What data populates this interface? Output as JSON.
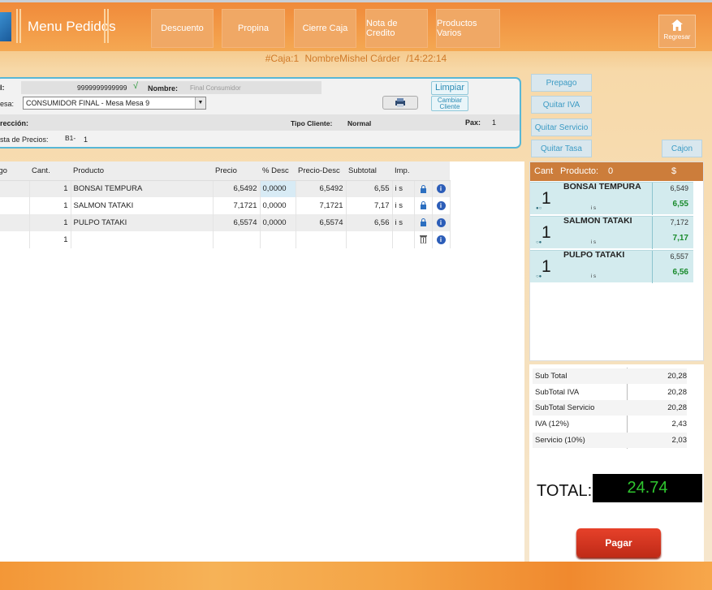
{
  "header": {
    "title": "Menu Pedidos",
    "buttons": [
      "Descuento",
      "Propina",
      "Cierre Caja",
      "Nota de Credito",
      "Productos Varios"
    ],
    "regresar": "Regresar"
  },
  "infobar": {
    "caja": "#Caja:1",
    "nombre": "NombreMishel Cárder",
    "hora": "/14:22:14"
  },
  "form": {
    "ruc_label": "I:",
    "ruc_value": "9999999999999",
    "check": "√",
    "nombre_label": "Nombre:",
    "nombre_value": "Final Consumidor",
    "limpiar": "Limpiar",
    "mesa_label": "esa:",
    "mesa_value": "CONSUMIDOR FINAL - Mesa Mesa 9",
    "cambiar_cliente": "Cambiar Cliente",
    "direccion_label": "rección:",
    "tipo_cliente_label": "Tipo Cliente:",
    "tipo_cliente_value": "Normal",
    "pax_label": "Pax:",
    "pax_value": "1",
    "lista_label": "sta de Precios:",
    "lista_code": "B1-",
    "lista_value": "1"
  },
  "side_buttons": {
    "prepago": "Prepago",
    "quitar_iva": "Quitar IVA",
    "quitar_servicio": "Quitar Servicio",
    "quitar_tasa": "Quitar Tasa",
    "cajon": "Cajon"
  },
  "table": {
    "headers": [
      "digo",
      "Cant.",
      "Producto",
      "Precio",
      "% Desc",
      "Precio-Desc",
      "Subtotal",
      "Imp."
    ],
    "rows": [
      {
        "cant": "1",
        "producto": "BONSAI TEMPURA",
        "precio": "6,5492",
        "desc": "0,0000",
        "precio_desc": "6,5492",
        "subtotal": "6,55",
        "imp": "i s"
      },
      {
        "cant": "1",
        "producto": "SALMON TATAKI",
        "precio": "7,1721",
        "desc": "0,0000",
        "precio_desc": "7,1721",
        "subtotal": "7,17",
        "imp": "i s"
      },
      {
        "cant": "1",
        "producto": "PULPO TATAKI",
        "precio": "6,5574",
        "desc": "0,0000",
        "precio_desc": "6,5574",
        "subtotal": "6,56",
        "imp": "i s"
      },
      {
        "cant": "1",
        "producto": "",
        "precio": "",
        "desc": "",
        "precio_desc": "",
        "subtotal": "",
        "imp": ""
      }
    ]
  },
  "order": {
    "h_cant": "Cant",
    "h_producto": "Producto:",
    "h_count": "0",
    "h_price": "$",
    "items": [
      {
        "qty": "1",
        "name": "BONSAI TEMPURA",
        "dots": "●○",
        "tax": "i s",
        "unit": "6,549",
        "total": "6,55"
      },
      {
        "qty": "1",
        "name": "SALMON TATAKI",
        "dots": "○●",
        "tax": "i s",
        "unit": "7,172",
        "total": "7,17"
      },
      {
        "qty": "1",
        "name": "PULPO TATAKI",
        "dots": "○●",
        "tax": "i s",
        "unit": "6,557",
        "total": "6,56"
      }
    ]
  },
  "totals": {
    "rows": [
      {
        "label": "Sub Total",
        "value": "20,28"
      },
      {
        "label": "SubTotal IVA",
        "value": "20,28"
      },
      {
        "label": "SubTotal Servicio",
        "value": "20,28"
      },
      {
        "label": "IVA (12%)",
        "value": "2,43"
      },
      {
        "label": "Servicio (10%)",
        "value": "2,03"
      }
    ],
    "total_label": "TOTAL:",
    "total_value": "24.74",
    "pagar": "Pagar"
  },
  "colors": {
    "header_orange": "#f08a3a",
    "accent_blue": "#58b7d6",
    "total_green": "#2fc62f",
    "pay_red": "#d8371f"
  }
}
